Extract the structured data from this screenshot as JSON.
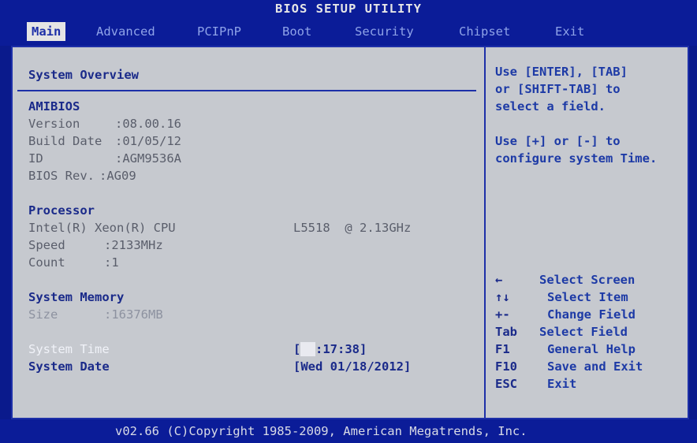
{
  "window": {
    "title": "BIOS SETUP UTILITY"
  },
  "menu": {
    "items": [
      {
        "label": "Main"
      },
      {
        "label": "Advanced"
      },
      {
        "label": "PCIPnP"
      },
      {
        "label": "Boot"
      },
      {
        "label": "Security"
      },
      {
        "label": "Chipset"
      },
      {
        "label": "Exit"
      }
    ]
  },
  "main": {
    "heading": "System Overview",
    "amibios": {
      "title": "AMIBIOS",
      "version": {
        "label": "Version",
        "value": ":08.00.16"
      },
      "build_date": {
        "label": "Build Date",
        "value": ":01/05/12"
      },
      "id": {
        "label": "ID",
        "value": ":AGM9536A"
      },
      "bios_rev": {
        "label": "BIOS Rev.",
        "value": ":AG09"
      }
    },
    "processor": {
      "title": "Processor",
      "name": "Intel(R) Xeon(R) CPU",
      "model": "L5518  @ 2.13GHz",
      "speed": {
        "label": "Speed",
        "value": ":2133MHz"
      },
      "count": {
        "label": "Count",
        "value": ":1"
      }
    },
    "memory": {
      "title": "System Memory",
      "size": {
        "label": "Size",
        "value": ":16376MB"
      }
    },
    "system_time": {
      "label": "System Time",
      "open": "[",
      "hour": "08",
      "rest": ":17:38]"
    },
    "system_date": {
      "label": "System Date",
      "value": "[Wed 01/18/2012]"
    }
  },
  "help": {
    "lines1": [
      "Use [ENTER], [TAB]",
      "or [SHIFT-TAB] to",
      "select a field."
    ],
    "lines2": [
      "Use [+] or [-] to",
      "configure system Time."
    ]
  },
  "keys": [
    {
      "key": "←",
      "desc": "Select Screen"
    },
    {
      "key": "↑↓",
      "desc": "Select Item"
    },
    {
      "key": "+-",
      "desc": "Change Field"
    },
    {
      "key": "Tab",
      "desc": "Select Field"
    },
    {
      "key": "F1",
      "desc": "General Help"
    },
    {
      "key": "F10",
      "desc": "Save and Exit"
    },
    {
      "key": "ESC",
      "desc": "Exit"
    }
  ],
  "footer": {
    "text": "v02.66 (C)Copyright 1985-2009, American Megatrends, Inc."
  }
}
